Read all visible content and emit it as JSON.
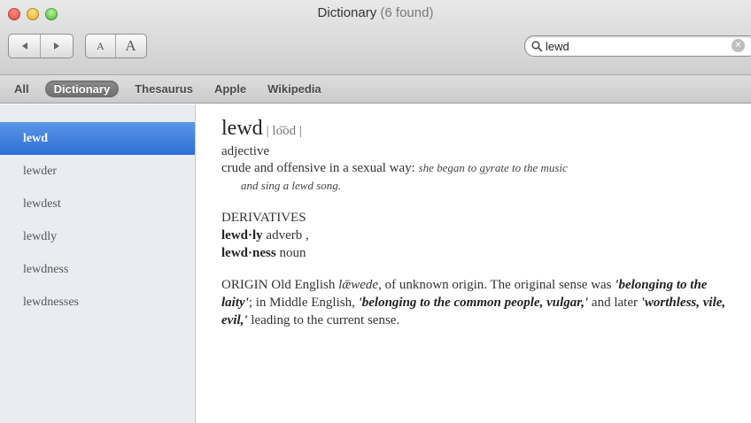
{
  "window": {
    "title": "Dictionary",
    "count": "(6 found)"
  },
  "toolbar": {
    "back_icon": "back-arrow-icon",
    "forward_icon": "forward-arrow-icon",
    "font_smaller_label": "A",
    "font_larger_label": "A"
  },
  "search": {
    "value": "lewd",
    "icon": "search-icon"
  },
  "sources": [
    {
      "label": "All"
    },
    {
      "label": "Dictionary",
      "active": true
    },
    {
      "label": "Thesaurus"
    },
    {
      "label": "Apple"
    },
    {
      "label": "Wikipedia"
    }
  ],
  "sidebar": {
    "items": [
      {
        "label": "lewd",
        "selected": true
      },
      {
        "label": "lewder"
      },
      {
        "label": "lewdest"
      },
      {
        "label": "lewdly"
      },
      {
        "label": "lewdness"
      },
      {
        "label": "lewdnesses"
      }
    ]
  },
  "entry": {
    "headword": "lewd",
    "pronunciation": "| lo͞od |",
    "pos": "adjective",
    "definition": "crude and offensive in a sexual way:",
    "example_line1": "she began to gyrate to the music",
    "example_line2": "and sing a lewd song.",
    "derivatives_heading": "DERIVATIVES",
    "derivative1_word": "lewd·ly",
    "derivative1_pos": "adverb ,",
    "derivative2_word": "lewd·ness",
    "derivative2_pos": "noun",
    "origin_label": "ORIGIN",
    "origin_text1": "Old English",
    "origin_oe": "lǣwede",
    "origin_text2": ", of unknown origin. The original sense was",
    "origin_sense1": "'belonging to the laity'",
    "origin_text3": "; in Middle English,",
    "origin_sense2": "'belonging to the common people, vulgar,'",
    "origin_text4": "and later",
    "origin_sense3": "'worthless, vile, evil,'",
    "origin_text5": "leading to the current sense."
  },
  "colors": {
    "selection": "#2d6fd4",
    "sidebar_bg": "#e9edf2",
    "active_tab": "#6d6d6d"
  }
}
